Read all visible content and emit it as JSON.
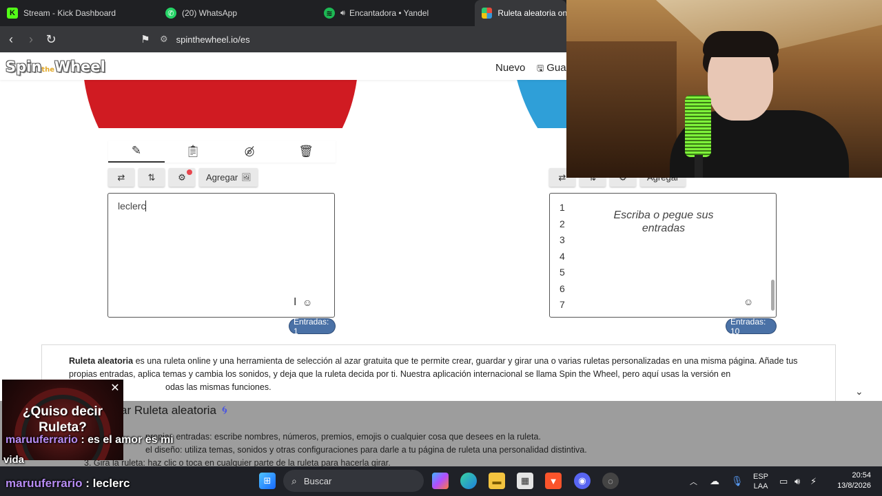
{
  "browser": {
    "tabs": [
      {
        "title": "Stream - Kick Dashboard",
        "icon": "kick-icon"
      },
      {
        "title": "(20) WhatsApp",
        "icon": "whatsapp-icon"
      },
      {
        "title": "Encantadora • Yandel",
        "icon": "spotify-icon"
      },
      {
        "title": "Ruleta aleatoria onl",
        "icon": "spinthewheel-icon"
      }
    ],
    "url": "spinthewheel.io/es"
  },
  "site": {
    "logo_left": "Spin",
    "logo_mid": "the",
    "logo_right": "Wheel",
    "nav_nuevo": "Nuevo",
    "nav_guardar": "Gua"
  },
  "editor_left": {
    "add_label": "Agregar",
    "text_value": "leclerc",
    "count_label": "Entradas: 1"
  },
  "editor_right": {
    "add_label": "Agregar",
    "placeholder": "Escriba o pegue sus entradas",
    "line_numbers": [
      "1",
      "2",
      "3",
      "4",
      "5",
      "6",
      "7"
    ],
    "count_label": "Entradas: 10"
  },
  "info": {
    "bold": "Ruleta aleatoria",
    "text": " es una ruleta online y una herramienta de selección al azar gratuita que te permite crear, guardar y girar una o varias ruletas personalizadas en una misma página. Añade tus propias entradas, aplica temas y cambia los sonidos, y deja que la ruleta decida por ti. Nuestra aplicación internacional se llama Spin the Wheel, pero aquí usas la versión en",
    "text_tail": "odas las mismas funciones.",
    "heading": "ar Ruleta aleatoria",
    "line1": "propias entradas: escribe nombres, números, premios, emojis o cualquier cosa que desees en la ruleta.",
    "line2": "el diseño: utiliza temas, sonidos y otras configuraciones para darle a tu página de ruleta una personalidad distintiva.",
    "line3": "3. Gira la ruleta: haz clic o toca en cualquier parte de la ruleta para hacerla girar."
  },
  "overlay": {
    "suggest_text": "¿Quiso decir Ruleta?",
    "chat": [
      {
        "user": "maruuferrario",
        "sep": " : ",
        "msg": "es el amor es mi"
      },
      {
        "user": "",
        "sep": "",
        "msg": "vida"
      },
      {
        "user": "maruuferrario",
        "sep": " : ",
        "msg": "leclerc"
      }
    ]
  },
  "taskbar": {
    "search": "Buscar",
    "lang_1": "ESP",
    "lang_2": "LAA",
    "time": "20:54",
    "date": "13/8/2026"
  }
}
